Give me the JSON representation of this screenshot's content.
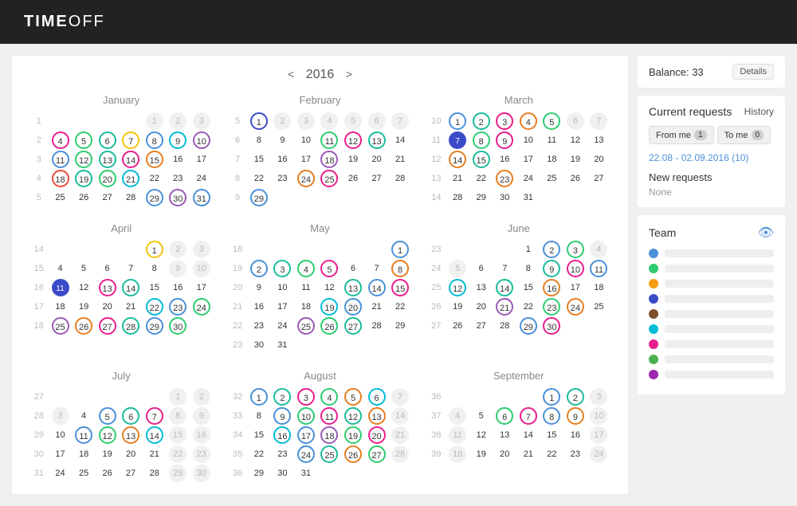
{
  "topbar": {
    "logo_time": "TIME",
    "logo_off": "OFF"
  },
  "calendar": {
    "year": "2016",
    "prev_label": "<",
    "next_label": ">",
    "months": [
      {
        "name": "January",
        "week_start_col": 5,
        "weeks": [
          "1",
          "",
          "",
          "",
          "",
          ""
        ]
      },
      {
        "name": "February",
        "weeks": []
      },
      {
        "name": "March",
        "weeks": []
      },
      {
        "name": "April",
        "weeks": []
      },
      {
        "name": "May",
        "weeks": []
      },
      {
        "name": "June",
        "weeks": []
      },
      {
        "name": "July",
        "weeks": []
      },
      {
        "name": "August",
        "weeks": []
      },
      {
        "name": "September",
        "weeks": []
      }
    ]
  },
  "sidebar": {
    "balance_label": "Balance: 33",
    "details_label": "Details",
    "current_requests_title": "Current requests",
    "history_label": "History",
    "from_me_label": "From me",
    "from_me_count": "1",
    "to_me_label": "To me",
    "to_me_count": "0",
    "request_link": "22.08 - 02.09.2016 (10)",
    "new_requests_title": "New requests",
    "new_requests_none": "None",
    "team_title": "Team",
    "team_members": [
      {
        "color": "#4a90d9"
      },
      {
        "color": "#2ecc71"
      },
      {
        "color": "#f39c12"
      },
      {
        "color": "#3b4bc8"
      },
      {
        "color": "#7d4e2a"
      },
      {
        "color": "#00bcd4"
      },
      {
        "color": "#e91e8c"
      },
      {
        "color": "#4caf50"
      },
      {
        "color": "#9c27b0"
      }
    ]
  }
}
